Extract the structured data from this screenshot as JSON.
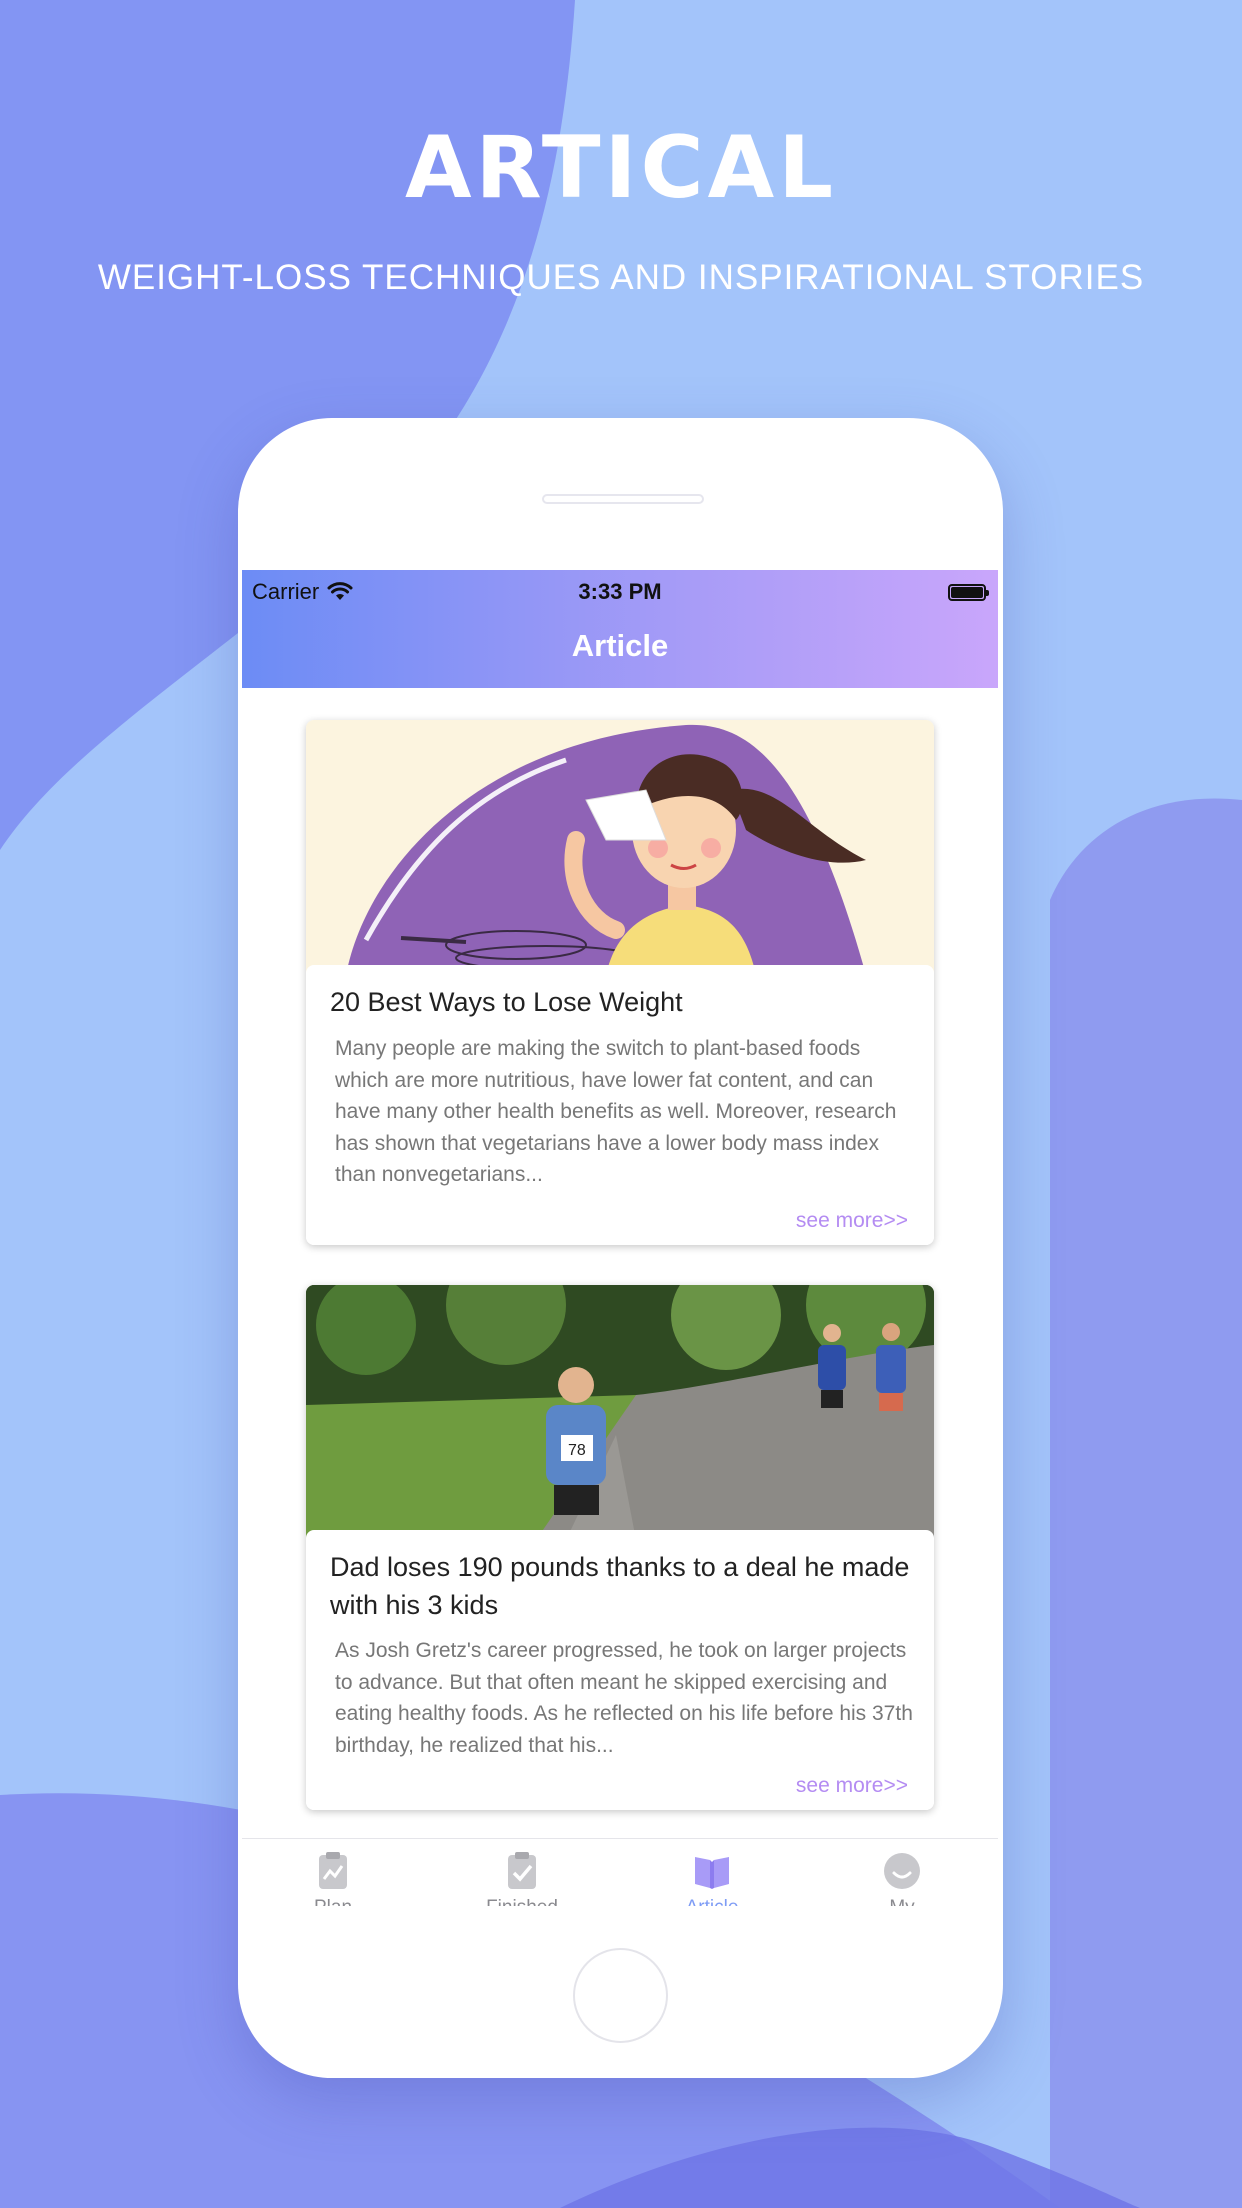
{
  "header": {
    "title": "ARTICAL",
    "subtitle": "WEIGHT-LOSS TECHNIQUES AND INSPIRATIONAL STORIES"
  },
  "status_bar": {
    "carrier": "Carrier",
    "time": "3:33 PM"
  },
  "navbar": {
    "title": "Article"
  },
  "articles": [
    {
      "title": "20 Best Ways to Lose Weight",
      "excerpt": "Many people are making the switch to plant-based foods which are more nutritious, have lower fat content, and can have many other health benefits as well. Moreover, research has shown that vegetarians have a lower body mass index than nonvegetarians...",
      "see_more": "see more>>"
    },
    {
      "title": "Dad loses 190 pounds thanks to a deal he  made with his 3 kids",
      "excerpt": "As Josh Gretz's career progressed, he took on larger projects to advance. But that often meant he skipped exercising and eating healthy foods. As he reflected on his life before his 37th birthday, he realized that his...",
      "see_more": "see more>>",
      "bib_number": "78"
    }
  ],
  "tabs": [
    {
      "label": "Plan",
      "icon": "chart-clipboard-icon",
      "active": false
    },
    {
      "label": "Finished",
      "icon": "checked-clipboard-icon",
      "active": false
    },
    {
      "label": "Article",
      "icon": "open-book-icon",
      "active": true
    },
    {
      "label": "My",
      "icon": "smiley-face-icon",
      "active": false
    }
  ],
  "colors": {
    "background_light": "#a3c4fa",
    "background_dark": "#7b86f0",
    "navbar_gradient_start": "#6c8cf5",
    "navbar_gradient_end": "#c9a6fb",
    "accent_link": "#b48cf2",
    "tab_active": "#7e9cf5",
    "tab_inactive": "#8a8a8f"
  }
}
